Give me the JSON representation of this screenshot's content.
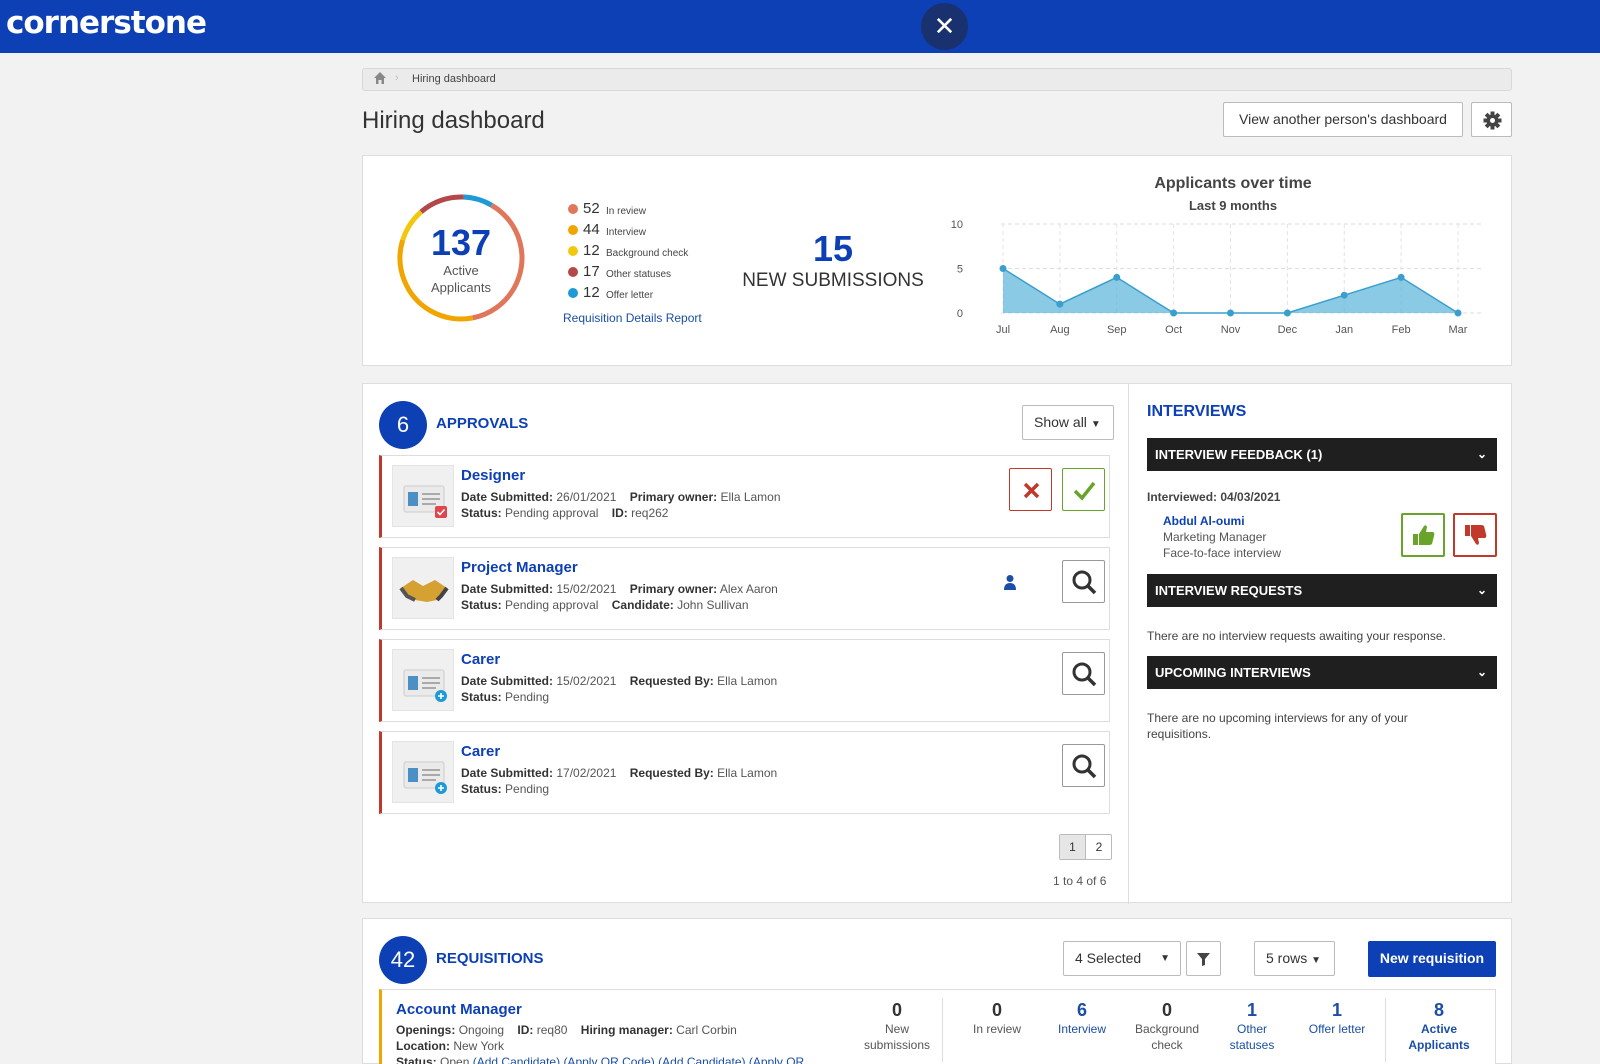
{
  "header": {
    "logo": "cornerstone",
    "close_icon": "✕"
  },
  "breadcrumb": {
    "current": "Hiring dashboard"
  },
  "page": {
    "title": "Hiring dashboard",
    "view_other_label": "View another person's dashboard"
  },
  "summary": {
    "active_count": "137",
    "active_label_1": "Active",
    "active_label_2": "Applicants",
    "legend": [
      {
        "value": "52",
        "label": "In review",
        "color": "#e0765a"
      },
      {
        "value": "44",
        "label": "Interview",
        "color": "#f0a500"
      },
      {
        "value": "12",
        "label": "Background check",
        "color": "#f2c80f"
      },
      {
        "value": "17",
        "label": "Other statuses",
        "color": "#b3474a"
      },
      {
        "value": "12",
        "label": "Offer letter",
        "color": "#1e9ad6"
      }
    ],
    "report_link": "Requisition Details Report",
    "new_submissions_count": "15",
    "new_submissions_label": "NEW SUBMISSIONS"
  },
  "chart_data": {
    "type": "area",
    "title": "Applicants over time",
    "subtitle": "Last 9 months",
    "categories": [
      "Jul",
      "Aug",
      "Sep",
      "Oct",
      "Nov",
      "Dec",
      "Jan",
      "Feb",
      "Mar"
    ],
    "values": [
      5,
      1,
      4,
      0,
      0,
      0,
      2,
      4,
      0
    ],
    "ylim": [
      0,
      10
    ],
    "yticks": [
      "10",
      "5",
      "0"
    ],
    "grid": true,
    "color": "#5ab4d9"
  },
  "approvals": {
    "count": "6",
    "heading": "APPROVALS",
    "show_all_label": "Show all",
    "items": [
      {
        "title": "Designer",
        "line1_k1": "Date Submitted:",
        "line1_v1": "26/01/2021",
        "line1_k2": "Primary owner:",
        "line1_v2": "Ella Lamon",
        "line2_k1": "Status:",
        "line2_v1": "Pending approval",
        "line2_k2": "ID:",
        "line2_v2": "req262"
      },
      {
        "title": "Project Manager",
        "line1_k1": "Date Submitted:",
        "line1_v1": "15/02/2021",
        "line1_k2": "Primary owner:",
        "line1_v2": "Alex Aaron",
        "line2_k1": "Status:",
        "line2_v1": "Pending approval",
        "line2_k2": "Candidate:",
        "line2_v2": "John Sullivan"
      },
      {
        "title": "Carer",
        "line1_k1": "Date Submitted:",
        "line1_v1": "15/02/2021",
        "line1_k2": "Requested By:",
        "line1_v2": "Ella Lamon",
        "line2_k1": "Status:",
        "line2_v1": "Pending"
      },
      {
        "title": "Carer",
        "line1_k1": "Date Submitted:",
        "line1_v1": "17/02/2021",
        "line1_k2": "Requested By:",
        "line1_v2": "Ella Lamon",
        "line2_k1": "Status:",
        "line2_v1": "Pending"
      }
    ],
    "pages": [
      "1",
      "2"
    ],
    "page_info": "1 to 4 of 6"
  },
  "interviews": {
    "heading": "INTERVIEWS",
    "feedback_bar": "INTERVIEW FEEDBACK (1)",
    "interviewed_date": "Interviewed: 04/03/2021",
    "candidate_name": "Abdul Al-oumi",
    "candidate_role": "Marketing Manager",
    "interview_type": "Face-to-face interview",
    "requests_bar": "INTERVIEW REQUESTS",
    "requests_empty": "There are no interview requests awaiting your response.",
    "upcoming_bar": "UPCOMING INTERVIEWS",
    "upcoming_empty": "There are no upcoming interviews for any of your requisitions."
  },
  "requisitions": {
    "count": "42",
    "heading": "REQUISITIONS",
    "selected_label": "4 Selected",
    "rows_label": "5 rows",
    "new_label": "New requisition",
    "item": {
      "title": "Account Manager",
      "openings_k": "Openings:",
      "openings_v": "Ongoing",
      "id_k": "ID:",
      "id_v": "req80",
      "hm_k": "Hiring manager:",
      "hm_v": "Carl Corbin",
      "location_k": "Location:",
      "location_v": "New York",
      "status_k": "Status:",
      "status_v": "Open",
      "links": "(Add Candidate) (Apply QR Code) (Add Candidate) (Apply QR"
    },
    "stats": [
      {
        "value": "0",
        "l1": "New",
        "l2": "submissions"
      },
      {
        "value": "0",
        "l1": "In review",
        "l2": ""
      },
      {
        "value": "6",
        "l1": "Interview",
        "l2": ""
      },
      {
        "value": "0",
        "l1": "Background",
        "l2": "check"
      },
      {
        "value": "1",
        "l1": "Other",
        "l2": "statuses"
      },
      {
        "value": "1",
        "l1": "Offer letter",
        "l2": ""
      },
      {
        "value": "8",
        "l1": "Active",
        "l2": "Applicants"
      }
    ]
  }
}
